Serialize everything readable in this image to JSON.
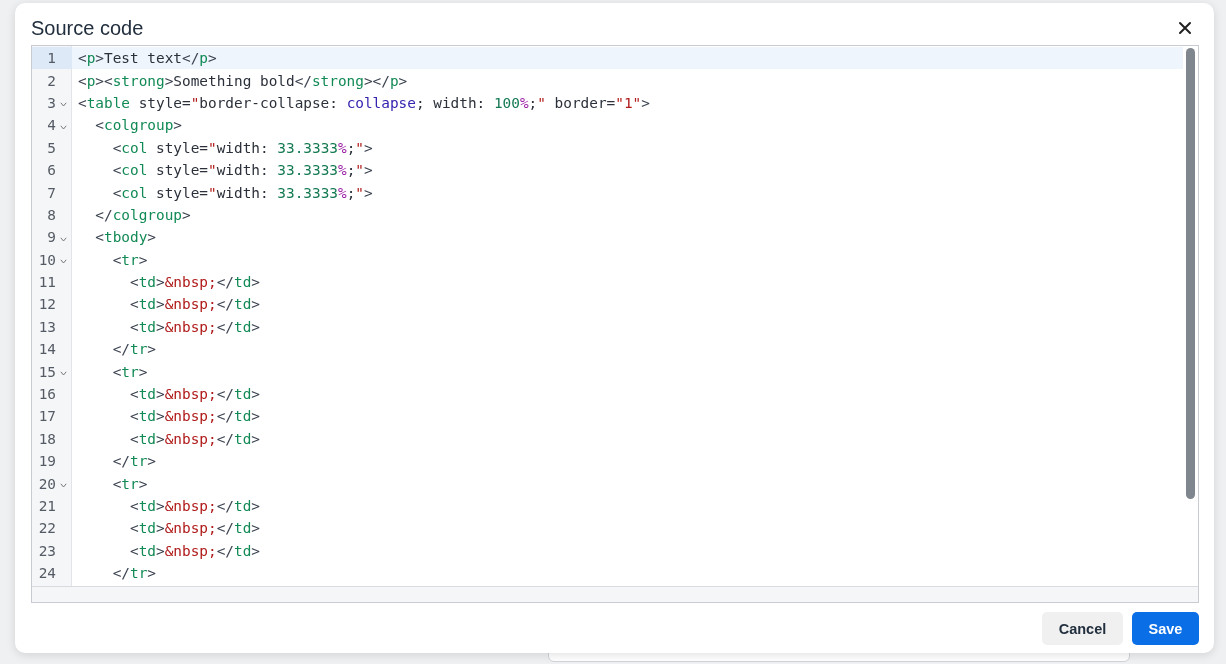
{
  "dialog": {
    "title": "Source code",
    "buttons": [
      {
        "label": "Cancel",
        "kind": "secondary"
      },
      {
        "label": "Save",
        "kind": "primary"
      }
    ]
  },
  "editor": {
    "lines": [
      {
        "number": "1",
        "active": true,
        "foldable": false,
        "tokens": [
          {
            "kind": "punct",
            "text": "<"
          },
          {
            "kind": "tag",
            "text": "p"
          },
          {
            "kind": "punct",
            "text": ">"
          },
          {
            "kind": "text",
            "text": "Test text"
          },
          {
            "kind": "punct",
            "text": "</"
          },
          {
            "kind": "tag",
            "text": "p"
          },
          {
            "kind": "punct",
            "text": ">"
          }
        ]
      },
      {
        "number": "2",
        "active": false,
        "foldable": false,
        "tokens": [
          {
            "kind": "punct",
            "text": "<"
          },
          {
            "kind": "tag",
            "text": "p"
          },
          {
            "kind": "punct",
            "text": "><"
          },
          {
            "kind": "tag",
            "text": "strong"
          },
          {
            "kind": "punct",
            "text": ">"
          },
          {
            "kind": "text",
            "text": "Something bold"
          },
          {
            "kind": "punct",
            "text": "</"
          },
          {
            "kind": "tag",
            "text": "strong"
          },
          {
            "kind": "punct",
            "text": "></"
          },
          {
            "kind": "tag",
            "text": "p"
          },
          {
            "kind": "punct",
            "text": ">"
          }
        ]
      },
      {
        "number": "3",
        "active": false,
        "foldable": true,
        "tokens": [
          {
            "kind": "punct",
            "text": "<"
          },
          {
            "kind": "tag",
            "text": "table"
          },
          {
            "kind": "text",
            "text": " style="
          },
          {
            "kind": "string",
            "text": "\""
          },
          {
            "kind": "text",
            "text": "border-collapse: "
          },
          {
            "kind": "keyword",
            "text": "collapse"
          },
          {
            "kind": "text",
            "text": "; width: "
          },
          {
            "kind": "number",
            "text": "100"
          },
          {
            "kind": "unit",
            "text": "%"
          },
          {
            "kind": "text",
            "text": ";"
          },
          {
            "kind": "string",
            "text": "\""
          },
          {
            "kind": "text",
            "text": " border="
          },
          {
            "kind": "string",
            "text": "\"1\""
          },
          {
            "kind": "punct",
            "text": ">"
          }
        ]
      },
      {
        "number": "4",
        "active": false,
        "foldable": true,
        "tokens": [
          {
            "kind": "punct",
            "text": "  <"
          },
          {
            "kind": "tag",
            "text": "colgroup"
          },
          {
            "kind": "punct",
            "text": ">"
          }
        ]
      },
      {
        "number": "5",
        "active": false,
        "foldable": false,
        "tokens": [
          {
            "kind": "punct",
            "text": "    <"
          },
          {
            "kind": "tag",
            "text": "col"
          },
          {
            "kind": "text",
            "text": " style="
          },
          {
            "kind": "string",
            "text": "\""
          },
          {
            "kind": "text",
            "text": "width: "
          },
          {
            "kind": "number",
            "text": "33.3333"
          },
          {
            "kind": "unit",
            "text": "%"
          },
          {
            "kind": "text",
            "text": ";"
          },
          {
            "kind": "string",
            "text": "\""
          },
          {
            "kind": "punct",
            "text": ">"
          }
        ]
      },
      {
        "number": "6",
        "active": false,
        "foldable": false,
        "tokens": [
          {
            "kind": "punct",
            "text": "    <"
          },
          {
            "kind": "tag",
            "text": "col"
          },
          {
            "kind": "text",
            "text": " style="
          },
          {
            "kind": "string",
            "text": "\""
          },
          {
            "kind": "text",
            "text": "width: "
          },
          {
            "kind": "number",
            "text": "33.3333"
          },
          {
            "kind": "unit",
            "text": "%"
          },
          {
            "kind": "text",
            "text": ";"
          },
          {
            "kind": "string",
            "text": "\""
          },
          {
            "kind": "punct",
            "text": ">"
          }
        ]
      },
      {
        "number": "7",
        "active": false,
        "foldable": false,
        "tokens": [
          {
            "kind": "punct",
            "text": "    <"
          },
          {
            "kind": "tag",
            "text": "col"
          },
          {
            "kind": "text",
            "text": " style="
          },
          {
            "kind": "string",
            "text": "\""
          },
          {
            "kind": "text",
            "text": "width: "
          },
          {
            "kind": "number",
            "text": "33.3333"
          },
          {
            "kind": "unit",
            "text": "%"
          },
          {
            "kind": "text",
            "text": ";"
          },
          {
            "kind": "string",
            "text": "\""
          },
          {
            "kind": "punct",
            "text": ">"
          }
        ]
      },
      {
        "number": "8",
        "active": false,
        "foldable": false,
        "tokens": [
          {
            "kind": "punct",
            "text": "  </"
          },
          {
            "kind": "tag",
            "text": "colgroup"
          },
          {
            "kind": "punct",
            "text": ">"
          }
        ]
      },
      {
        "number": "9",
        "active": false,
        "foldable": true,
        "tokens": [
          {
            "kind": "punct",
            "text": "  <"
          },
          {
            "kind": "tag",
            "text": "tbody"
          },
          {
            "kind": "punct",
            "text": ">"
          }
        ]
      },
      {
        "number": "10",
        "active": false,
        "foldable": true,
        "tokens": [
          {
            "kind": "punct",
            "text": "    <"
          },
          {
            "kind": "tag",
            "text": "tr"
          },
          {
            "kind": "punct",
            "text": ">"
          }
        ]
      },
      {
        "number": "11",
        "active": false,
        "foldable": false,
        "tokens": [
          {
            "kind": "punct",
            "text": "      <"
          },
          {
            "kind": "tag",
            "text": "td"
          },
          {
            "kind": "punct",
            "text": ">"
          },
          {
            "kind": "string",
            "text": "&nbsp;"
          },
          {
            "kind": "punct",
            "text": "</"
          },
          {
            "kind": "tag",
            "text": "td"
          },
          {
            "kind": "punct",
            "text": ">"
          }
        ]
      },
      {
        "number": "12",
        "active": false,
        "foldable": false,
        "tokens": [
          {
            "kind": "punct",
            "text": "      <"
          },
          {
            "kind": "tag",
            "text": "td"
          },
          {
            "kind": "punct",
            "text": ">"
          },
          {
            "kind": "string",
            "text": "&nbsp;"
          },
          {
            "kind": "punct",
            "text": "</"
          },
          {
            "kind": "tag",
            "text": "td"
          },
          {
            "kind": "punct",
            "text": ">"
          }
        ]
      },
      {
        "number": "13",
        "active": false,
        "foldable": false,
        "tokens": [
          {
            "kind": "punct",
            "text": "      <"
          },
          {
            "kind": "tag",
            "text": "td"
          },
          {
            "kind": "punct",
            "text": ">"
          },
          {
            "kind": "string",
            "text": "&nbsp;"
          },
          {
            "kind": "punct",
            "text": "</"
          },
          {
            "kind": "tag",
            "text": "td"
          },
          {
            "kind": "punct",
            "text": ">"
          }
        ]
      },
      {
        "number": "14",
        "active": false,
        "foldable": false,
        "tokens": [
          {
            "kind": "punct",
            "text": "    </"
          },
          {
            "kind": "tag",
            "text": "tr"
          },
          {
            "kind": "punct",
            "text": ">"
          }
        ]
      },
      {
        "number": "15",
        "active": false,
        "foldable": true,
        "tokens": [
          {
            "kind": "punct",
            "text": "    <"
          },
          {
            "kind": "tag",
            "text": "tr"
          },
          {
            "kind": "punct",
            "text": ">"
          }
        ]
      },
      {
        "number": "16",
        "active": false,
        "foldable": false,
        "tokens": [
          {
            "kind": "punct",
            "text": "      <"
          },
          {
            "kind": "tag",
            "text": "td"
          },
          {
            "kind": "punct",
            "text": ">"
          },
          {
            "kind": "string",
            "text": "&nbsp;"
          },
          {
            "kind": "punct",
            "text": "</"
          },
          {
            "kind": "tag",
            "text": "td"
          },
          {
            "kind": "punct",
            "text": ">"
          }
        ]
      },
      {
        "number": "17",
        "active": false,
        "foldable": false,
        "tokens": [
          {
            "kind": "punct",
            "text": "      <"
          },
          {
            "kind": "tag",
            "text": "td"
          },
          {
            "kind": "punct",
            "text": ">"
          },
          {
            "kind": "string",
            "text": "&nbsp;"
          },
          {
            "kind": "punct",
            "text": "</"
          },
          {
            "kind": "tag",
            "text": "td"
          },
          {
            "kind": "punct",
            "text": ">"
          }
        ]
      },
      {
        "number": "18",
        "active": false,
        "foldable": false,
        "tokens": [
          {
            "kind": "punct",
            "text": "      <"
          },
          {
            "kind": "tag",
            "text": "td"
          },
          {
            "kind": "punct",
            "text": ">"
          },
          {
            "kind": "string",
            "text": "&nbsp;"
          },
          {
            "kind": "punct",
            "text": "</"
          },
          {
            "kind": "tag",
            "text": "td"
          },
          {
            "kind": "punct",
            "text": ">"
          }
        ]
      },
      {
        "number": "19",
        "active": false,
        "foldable": false,
        "tokens": [
          {
            "kind": "punct",
            "text": "    </"
          },
          {
            "kind": "tag",
            "text": "tr"
          },
          {
            "kind": "punct",
            "text": ">"
          }
        ]
      },
      {
        "number": "20",
        "active": false,
        "foldable": true,
        "tokens": [
          {
            "kind": "punct",
            "text": "    <"
          },
          {
            "kind": "tag",
            "text": "tr"
          },
          {
            "kind": "punct",
            "text": ">"
          }
        ]
      },
      {
        "number": "21",
        "active": false,
        "foldable": false,
        "tokens": [
          {
            "kind": "punct",
            "text": "      <"
          },
          {
            "kind": "tag",
            "text": "td"
          },
          {
            "kind": "punct",
            "text": ">"
          },
          {
            "kind": "string",
            "text": "&nbsp;"
          },
          {
            "kind": "punct",
            "text": "</"
          },
          {
            "kind": "tag",
            "text": "td"
          },
          {
            "kind": "punct",
            "text": ">"
          }
        ]
      },
      {
        "number": "22",
        "active": false,
        "foldable": false,
        "tokens": [
          {
            "kind": "punct",
            "text": "      <"
          },
          {
            "kind": "tag",
            "text": "td"
          },
          {
            "kind": "punct",
            "text": ">"
          },
          {
            "kind": "string",
            "text": "&nbsp;"
          },
          {
            "kind": "punct",
            "text": "</"
          },
          {
            "kind": "tag",
            "text": "td"
          },
          {
            "kind": "punct",
            "text": ">"
          }
        ]
      },
      {
        "number": "23",
        "active": false,
        "foldable": false,
        "tokens": [
          {
            "kind": "punct",
            "text": "      <"
          },
          {
            "kind": "tag",
            "text": "td"
          },
          {
            "kind": "punct",
            "text": ">"
          },
          {
            "kind": "string",
            "text": "&nbsp;"
          },
          {
            "kind": "punct",
            "text": "</"
          },
          {
            "kind": "tag",
            "text": "td"
          },
          {
            "kind": "punct",
            "text": ">"
          }
        ]
      },
      {
        "number": "24",
        "active": false,
        "foldable": false,
        "tokens": [
          {
            "kind": "punct",
            "text": "    </"
          },
          {
            "kind": "tag",
            "text": "tr"
          },
          {
            "kind": "punct",
            "text": ">"
          }
        ]
      }
    ]
  }
}
